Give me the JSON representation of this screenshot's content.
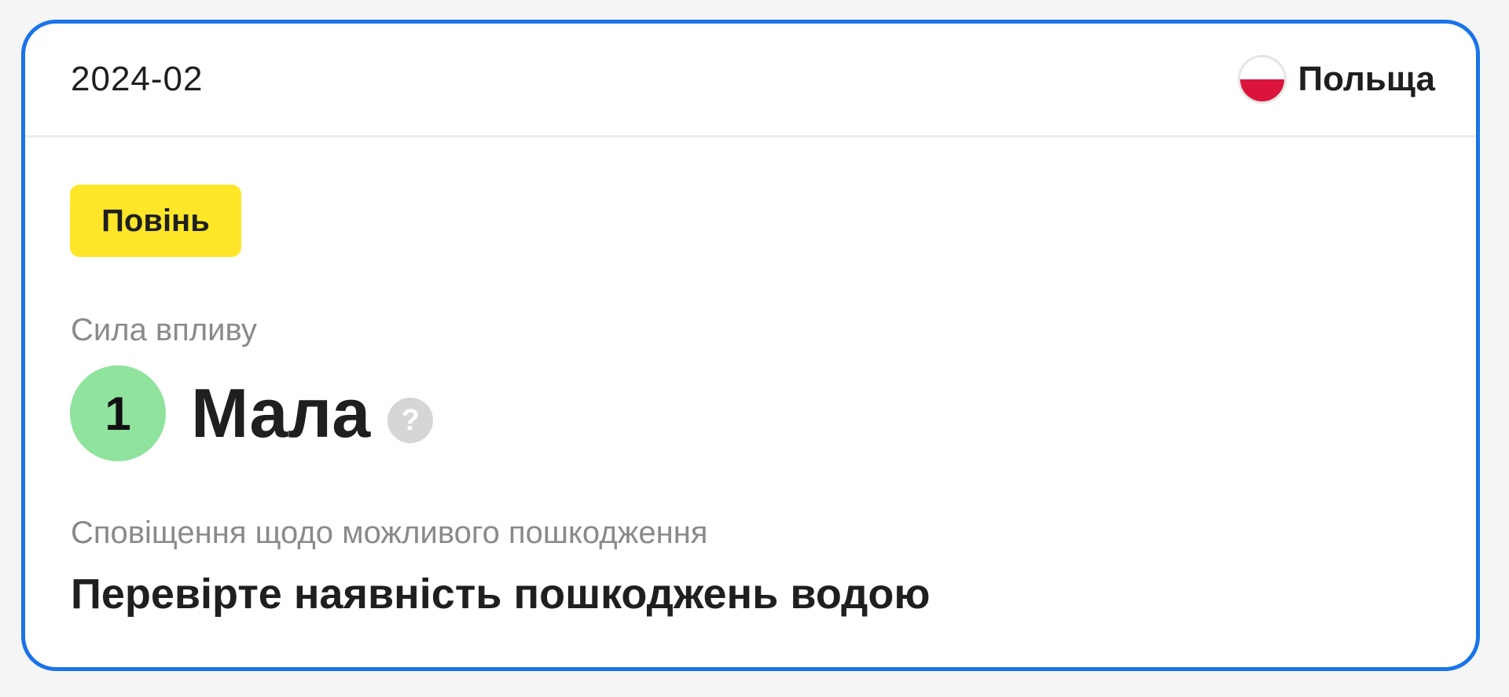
{
  "card": {
    "date": "2024-02",
    "country": {
      "name": "Польща",
      "flag_icon": "poland-flag-icon",
      "flag_colors": [
        "#ffffff",
        "#dc143c"
      ]
    },
    "event_badge": {
      "label": "Повінь",
      "color": "#ffe629"
    },
    "impact": {
      "label": "Сила впливу",
      "level_number": "1",
      "level_text": "Мала",
      "level_color": "#8fe39d",
      "help_icon": "question-mark-icon",
      "help_glyph": "?"
    },
    "alert": {
      "label": "Сповіщення щодо можливого пошкодження",
      "text": "Перевірте наявність пошкоджень водою"
    },
    "accent_color": "#1a73e8"
  }
}
